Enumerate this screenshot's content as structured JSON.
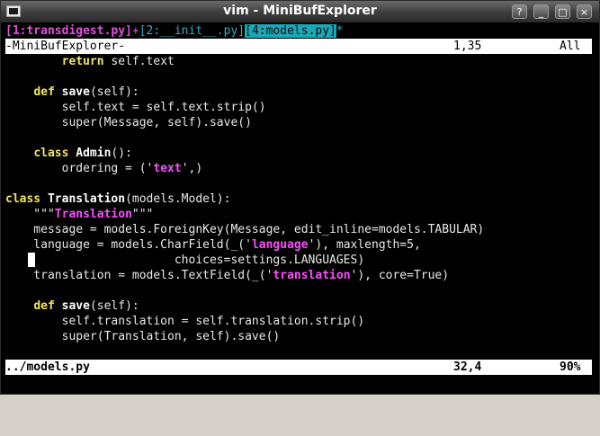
{
  "window": {
    "title": "vim - MiniBufExplorer"
  },
  "titlebar_buttons": [
    "?",
    "_",
    "□",
    "×"
  ],
  "buffers": {
    "b1": "[1:transdigest.py]",
    "plus1": "+",
    "b2": "[2:__init__.py]",
    "b3": "[4:models.py]",
    "star": "*"
  },
  "top_status": {
    "name": "-MiniBufExplorer-",
    "pos": "1,35",
    "scroll": "All"
  },
  "code": {
    "l1a": "        ",
    "l1b": "return",
    "l1c": " self.text",
    "l3a": "    ",
    "l3b": "def",
    "l3c": " ",
    "l3d": "save",
    "l3e": "(self):",
    "l4": "        self.text = self.text.strip()",
    "l5": "        super(Message, self).save()",
    "l7a": "    ",
    "l7b": "class",
    "l7c": " ",
    "l7d": "Admin",
    "l7e": "():",
    "l8a": "        ordering = ('",
    "l8b": "text",
    "l8c": "',)",
    "l10a": "class",
    "l10b": " ",
    "l10c": "Translation",
    "l10d": "(models.Model):",
    "l11a": "    \"\"\"",
    "l11b": "Translation",
    "l11c": "\"\"\"",
    "l12": "    message = models.ForeignKey(Message, edit_inline=models.TABULAR)",
    "l13a": "    language = models.CharField(_('",
    "l13b": "language",
    "l13c": "'), maxlength=5,",
    "l14": "                        choices=settings.LANGUAGES)",
    "l15a": "    translation = models.TextField(_('",
    "l15b": "translation",
    "l15c": "'), core=True)",
    "l17a": "    ",
    "l17b": "def",
    "l17c": " ",
    "l17d": "save",
    "l17e": "(self):",
    "l18": "        self.translation = self.translation.strip()",
    "l19": "        super(Translation, self).save()"
  },
  "bottom_status": {
    "name": "../models.py",
    "pos": "32,4",
    "scroll": "90%"
  }
}
